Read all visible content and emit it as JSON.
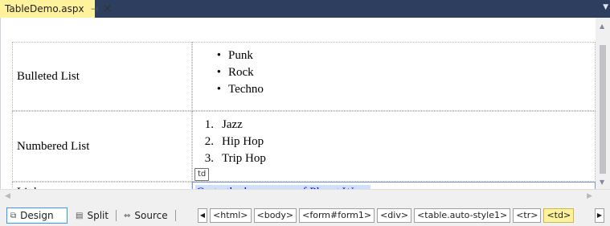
{
  "tab": {
    "title": "TableDemo.aspx",
    "pin_icon": "pin-icon",
    "close_symbol": "✕"
  },
  "table": {
    "rows": [
      {
        "label": "Bulleted List",
        "items": [
          "Punk",
          "Rock",
          "Techno"
        ]
      },
      {
        "label": "Numbered List",
        "items": [
          "Jazz",
          "Hip Hop",
          "Trip Hop"
        ],
        "markers": [
          "1.",
          "2.",
          "3."
        ],
        "badge": "td"
      },
      {
        "label": "Link",
        "link_text": "Go to the homepage of Planet Wrox"
      }
    ]
  },
  "views": {
    "design": "Design",
    "split": "Split",
    "source": "Source"
  },
  "breadcrumbs": [
    "<html>",
    "<body>",
    "<form#form1>",
    "<div>",
    "<table.auto-style1>",
    "<tr>",
    "<td>"
  ],
  "colors": {
    "tab_active": "#fff29d",
    "tab_strip": "#2d3e5e",
    "link": "#0000ee",
    "selection": "#3399ff"
  }
}
